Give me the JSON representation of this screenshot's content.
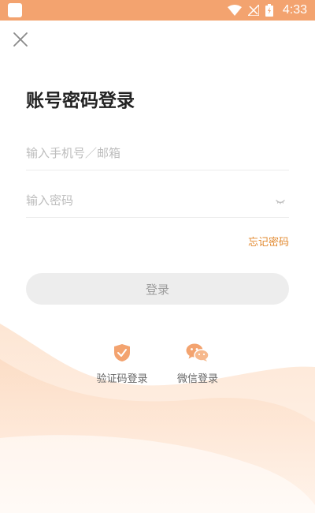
{
  "status_bar": {
    "time": "4:33"
  },
  "icons": {
    "close": "close-icon",
    "eye": "eye-closed-icon",
    "code": "shield-check-icon",
    "wechat": "wechat-icon"
  },
  "colors": {
    "accent": "#f3a36f",
    "link": "#e2892f",
    "button_bg": "#ededed"
  },
  "login": {
    "title": "账号密码登录",
    "account_placeholder": "输入手机号／邮箱",
    "password_placeholder": "输入密码",
    "forgot_label": "忘记密码",
    "login_label": "登录"
  },
  "alt_logins": [
    {
      "label": "验证码登录"
    },
    {
      "label": "微信登录"
    }
  ]
}
